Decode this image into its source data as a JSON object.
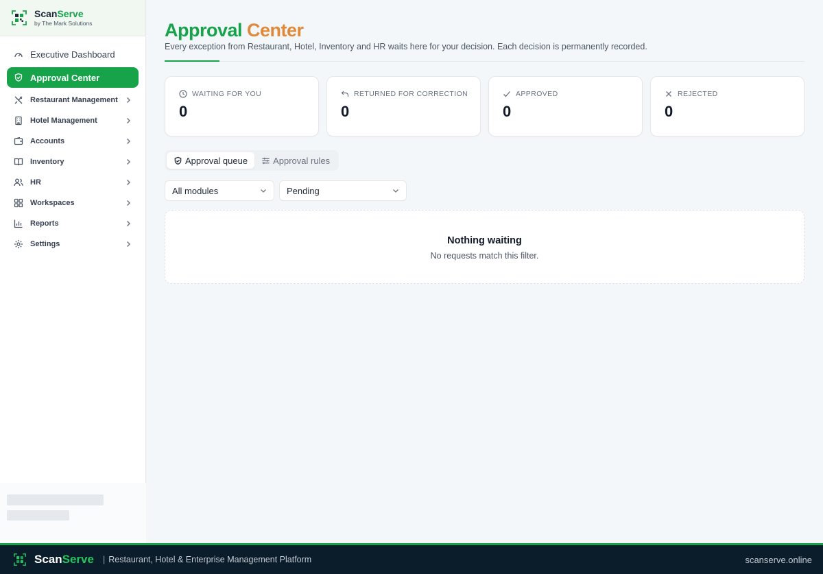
{
  "brand": {
    "name_part1": "Scan",
    "name_part2": "Serve",
    "subtitle": "by The Mark Solutions"
  },
  "sidebar": {
    "items": [
      {
        "label": "Executive Dashboard",
        "icon": "gauge-icon"
      },
      {
        "label": "Approval Center",
        "icon": "shield-check-icon",
        "active": true
      },
      {
        "label": "Restaurant Management",
        "icon": "utensils-icon"
      },
      {
        "label": "Hotel Management",
        "icon": "building-icon"
      },
      {
        "label": "Accounts",
        "icon": "wallet-icon"
      },
      {
        "label": "Inventory",
        "icon": "book-icon"
      },
      {
        "label": "HR",
        "icon": "users-icon"
      },
      {
        "label": "Workspaces",
        "icon": "grid-icon"
      },
      {
        "label": "Reports",
        "icon": "bar-chart-icon"
      },
      {
        "label": "Settings",
        "icon": "gear-icon"
      }
    ]
  },
  "page": {
    "title_part1": "Approval",
    "title_part2": "Center",
    "subtitle": "Every exception from Restaurant, Hotel, Inventory and HR waits here for your decision. Each decision is permanently recorded."
  },
  "stats": [
    {
      "label": "WAITING FOR YOU",
      "value": "0",
      "icon": "clock-icon"
    },
    {
      "label": "RETURNED FOR CORRECTION",
      "value": "0",
      "icon": "undo-icon"
    },
    {
      "label": "APPROVED",
      "value": "0",
      "icon": "check-icon"
    },
    {
      "label": "REJECTED",
      "value": "0",
      "icon": "x-icon"
    }
  ],
  "tabs": [
    {
      "label": "Approval queue",
      "icon": "shield-check-icon",
      "active": true
    },
    {
      "label": "Approval rules",
      "icon": "sliders-icon"
    }
  ],
  "filters": {
    "module": "All modules",
    "status": "Pending"
  },
  "empty_state": {
    "title": "Nothing waiting",
    "subtitle": "No requests match this filter."
  },
  "footer": {
    "brand_part1": "Scan",
    "brand_part2": "Serve",
    "separator": "|",
    "tagline": "Restaurant, Hotel & Enterprise Management Platform",
    "domain": "scanserve.online"
  },
  "colors": {
    "brand_green": "#16a34a",
    "title_orange": "#e0893b",
    "footer_bg": "#0b1c2a"
  }
}
